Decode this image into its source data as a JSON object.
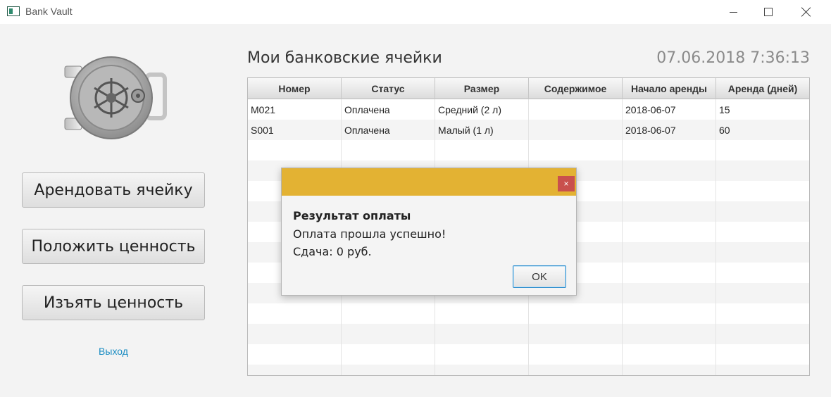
{
  "window": {
    "title": "Bank Vault"
  },
  "sidebar": {
    "rent_label": "Арендовать ячейку",
    "put_label": "Положить ценность",
    "take_label": "Изъять ценность",
    "exit_label": "Выход"
  },
  "header": {
    "title": "Мои банковские ячейки",
    "datetime": "07.06.2018 7:36:13"
  },
  "table": {
    "columns": [
      "Номер",
      "Статус",
      "Размер",
      "Содержимое",
      "Начало аренды",
      "Аренда (дней)"
    ],
    "rows": [
      [
        "M021",
        "Оплачена",
        "Средний (2 л)",
        "",
        "2018-06-07",
        "15"
      ],
      [
        "S001",
        "Оплачена",
        "Малый (1 л)",
        "",
        "2018-06-07",
        "60"
      ]
    ]
  },
  "dialog": {
    "heading": "Результат оплаты",
    "line1": "Оплата прошла успешно!",
    "line2": "Сдача: 0 руб.",
    "ok_label": "OK",
    "close_glyph": "×",
    "header_color": "#e3b233",
    "close_color": "#c9504d"
  },
  "colors": {
    "link": "#1a8cc2"
  }
}
